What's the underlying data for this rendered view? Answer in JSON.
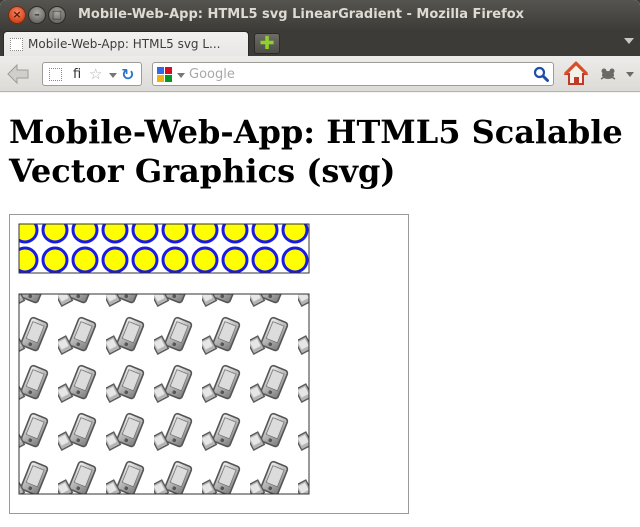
{
  "window": {
    "title": "Mobile-Web-App: HTML5 svg LinearGradient - Mozilla Firefox"
  },
  "tabs": [
    {
      "label": "Mobile-Web-App: HTML5 svg L..."
    }
  ],
  "navbar": {
    "url_text": "fi",
    "search_placeholder": "Google"
  },
  "page": {
    "heading": "Mobile-Web-App: HTML5 Scalable Vector Graphics (svg)"
  },
  "colors": {
    "circle_fill": "#ffff00",
    "circle_stroke": "#1a1ae6",
    "pattern_bg_1": "#ffffff",
    "phone_gray": "#888888"
  },
  "icons": [
    "close-icon",
    "minimize-icon",
    "maximize-icon",
    "tab-favicon",
    "new-tab-icon",
    "back-arrow-icon",
    "page-favicon",
    "star-icon",
    "reload-icon",
    "google-icon",
    "magnifier-icon",
    "home-icon",
    "addon-icon"
  ]
}
